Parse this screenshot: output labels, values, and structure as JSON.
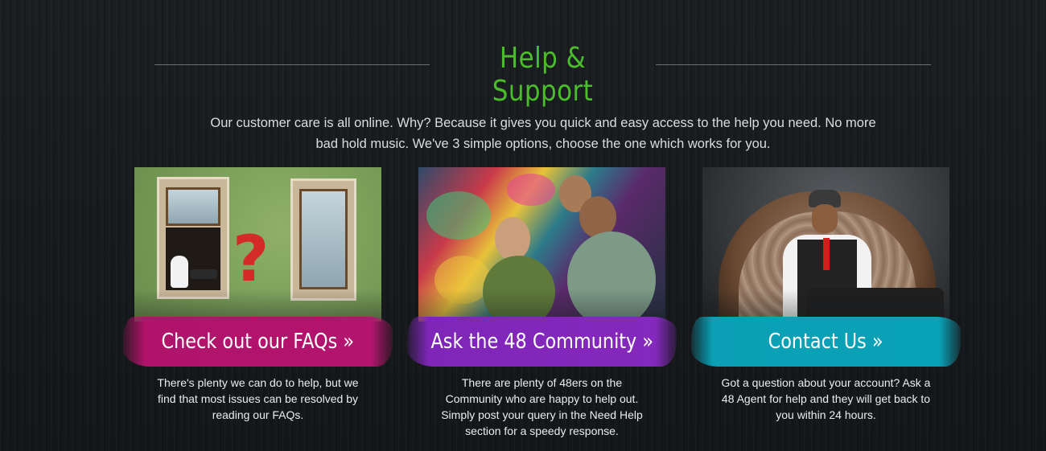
{
  "section": {
    "title": "Help & Support",
    "intro": "Our customer care is all online. Why? Because it gives you quick and easy access to the help you need. No more bad hold music. We've 3 simple options, choose the one which works for you."
  },
  "cards": [
    {
      "button_label": "Check out our FAQs »",
      "description": "There's plenty we can do to help, but we find that most issues can be resolved by reading our FAQs.",
      "color": "#b3156e"
    },
    {
      "button_label": "Ask the 48 Community »",
      "description": "There are plenty of 48ers on the Community who are happy to help out. Simply post your query in the Need Help section for a speedy response.",
      "color": "#8528bd"
    },
    {
      "button_label": "Contact Us »",
      "description": "Got a question about your account? Ask a 48 Agent for help and they will get back to you within 24 hours.",
      "color": "#0aa2b7"
    }
  ],
  "colors": {
    "title": "#4bbd2c",
    "background": "#16191c"
  }
}
